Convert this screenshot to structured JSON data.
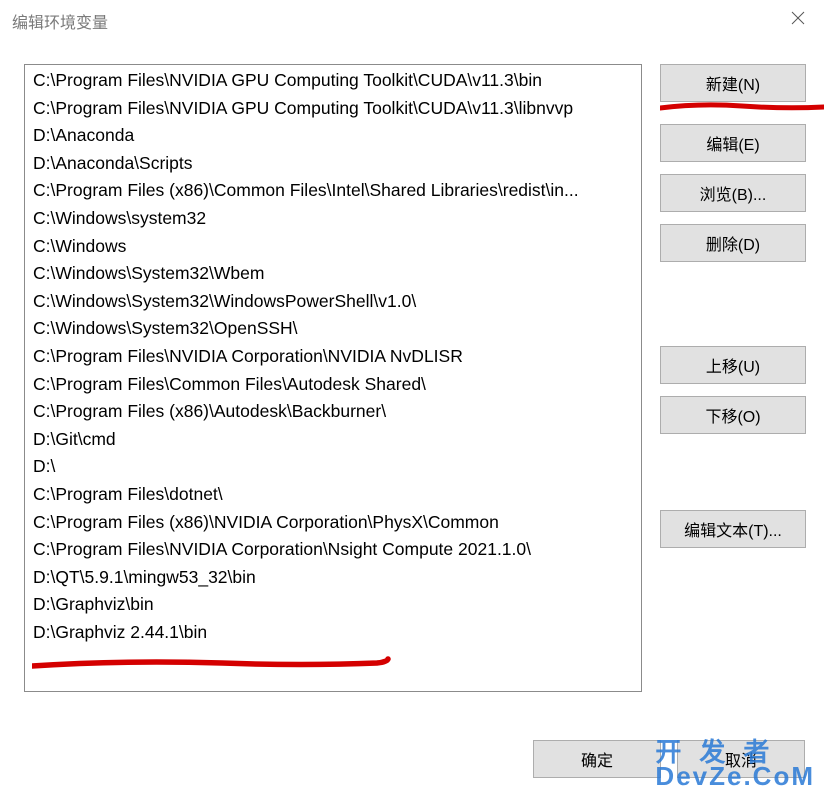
{
  "title": "编辑环境变量",
  "list": [
    "C:\\Program Files\\NVIDIA GPU Computing Toolkit\\CUDA\\v11.3\\bin",
    "C:\\Program Files\\NVIDIA GPU Computing Toolkit\\CUDA\\v11.3\\libnvvp",
    "D:\\Anaconda",
    "D:\\Anaconda\\Scripts",
    "C:\\Program Files (x86)\\Common Files\\Intel\\Shared Libraries\\redist\\in...",
    "C:\\Windows\\system32",
    "C:\\Windows",
    "C:\\Windows\\System32\\Wbem",
    "C:\\Windows\\System32\\WindowsPowerShell\\v1.0\\",
    "C:\\Windows\\System32\\OpenSSH\\",
    "C:\\Program Files\\NVIDIA Corporation\\NVIDIA NvDLISR",
    "C:\\Program Files\\Common Files\\Autodesk Shared\\",
    "C:\\Program Files (x86)\\Autodesk\\Backburner\\",
    "D:\\Git\\cmd",
    "D:\\",
    "C:\\Program Files\\dotnet\\",
    "C:\\Program Files (x86)\\NVIDIA Corporation\\PhysX\\Common",
    "C:\\Program Files\\NVIDIA Corporation\\Nsight Compute 2021.1.0\\",
    "D:\\QT\\5.9.1\\mingw53_32\\bin",
    "D:\\Graphviz\\bin",
    "D:\\Graphviz 2.44.1\\bin"
  ],
  "buttons": {
    "new": "新建(N)",
    "edit": "编辑(E)",
    "browse": "浏览(B)...",
    "delete": "删除(D)",
    "moveup": "上移(U)",
    "movedown": "下移(O)",
    "edittext": "编辑文本(T)...",
    "ok": "确定",
    "cancel": "取消"
  },
  "watermark": {
    "line1": "开发者",
    "line2": "DevZe.CoM"
  }
}
